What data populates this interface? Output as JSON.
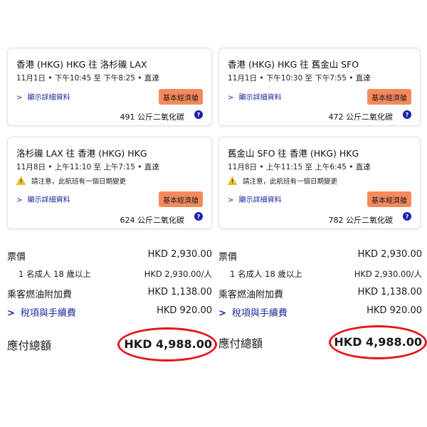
{
  "flights": [
    {
      "route": "香港 (HKG) HKG 往 洛杉磯 LAX",
      "time": "11月1日 • 下午10:45 至 下午8:25 • 直達",
      "notice": "",
      "details_link": "顯示詳細資料",
      "fare_class": "基本經濟艙",
      "co2": "491 公斤二氧化碳",
      "help": "?"
    },
    {
      "route": "香港 (HKG) HKG 往 舊金山 SFO",
      "time": "11月1日 • 下午10:30 至 下午7:55 • 直達",
      "notice": "",
      "details_link": "顯示詳細資料",
      "fare_class": "基本經濟艙",
      "co2": "472 公斤二氧化碳",
      "help": "?"
    },
    {
      "route": "洛杉磯 LAX 往 香港 (HKG) HKG",
      "time": "11月8日 • 上午11:10 至 上午7:15 • 直達",
      "notice": "請注意，此航班有一個日期變更",
      "details_link": "顯示詳細資料",
      "fare_class": "基本經濟艙",
      "co2": "624 公斤二氧化碳",
      "help": "?"
    },
    {
      "route": "舊金山 SFO 往 香港 (HKG) HKG",
      "time": "11月8日 • 上午11:15 至 上午6:45 • 直達",
      "notice": "請注意，此航班有一個日期變更",
      "details_link": "顯示詳細資料",
      "fare_class": "基本經濟艙",
      "co2": "782 公斤二氧化碳",
      "help": "?"
    }
  ],
  "summaries": [
    {
      "fare_label": "票價",
      "fare_value": "HKD 2,930.00",
      "adult_label": "1 名成人 18 歲以上",
      "adult_value": "HKD 2,930.00/人",
      "surcharge_label": "乘客燃油附加費",
      "surcharge_value": "HKD 1,138.00",
      "tax_label": "稅項與手續費",
      "tax_value": "HKD 920.00",
      "total_label": "應付總額",
      "total_value": "HKD 4,988.00"
    },
    {
      "fare_label": "票價",
      "fare_value": "HKD 2,930.00",
      "adult_label": "1 名成人 18 歲以上",
      "adult_value": "HKD 2,930.00/人",
      "surcharge_label": "乘客燃油附加費",
      "surcharge_value": "HKD 1,138.00",
      "tax_label": "稅項與手續費",
      "tax_value": "HKD 920.00",
      "total_label": "應付總額",
      "total_value": "HKD 4,988.00"
    }
  ],
  "icons": {
    "details_chevron": "chevron-right-icon",
    "tax_chevron": "chevron-right-icon",
    "warning": "warning-icon",
    "help": "help-icon"
  },
  "colors": {
    "fare_badge": "#f48a5c",
    "link": "#1f2a9a",
    "help_icon": "#1d1db8",
    "highlight": "#e5161d"
  }
}
